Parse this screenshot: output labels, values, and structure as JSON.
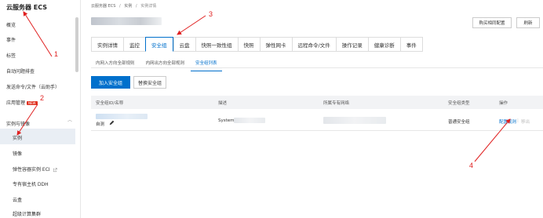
{
  "sidebar": {
    "title": "云服务器 ECS",
    "items": [
      {
        "label": "概览"
      },
      {
        "label": "事件"
      },
      {
        "label": "标签"
      },
      {
        "label": "自动问题排查"
      },
      {
        "label": "发送命令/文件（云助手）"
      },
      {
        "label": "应用管理",
        "badge": "NEW"
      },
      {
        "label": "实例与镜像"
      }
    ],
    "sub_items": [
      {
        "label": "实例"
      },
      {
        "label": "镜像"
      },
      {
        "label": "弹性容器实例 ECI"
      },
      {
        "label": "专有宿主机 DDH"
      },
      {
        "label": "云盒"
      },
      {
        "label": "超级计算集群"
      }
    ],
    "collapse_glyph": "︿"
  },
  "breadcrumb": [
    "云服务器 ECS",
    "/",
    "实例",
    "/",
    "实例详情"
  ],
  "header": {
    "buttons": [
      {
        "label": "购买相同配置"
      },
      {
        "label": "刷新"
      }
    ]
  },
  "tabs": [
    {
      "label": "实例详情"
    },
    {
      "label": "监控"
    },
    {
      "label": "安全组",
      "active": true
    },
    {
      "label": "云盘"
    },
    {
      "label": "快照一致性组"
    },
    {
      "label": "快照"
    },
    {
      "label": "弹性网卡"
    },
    {
      "label": "远程命令/文件"
    },
    {
      "label": "操作记录"
    },
    {
      "label": "健康诊断"
    },
    {
      "label": "事件"
    }
  ],
  "subtabs": [
    {
      "label": "内网入方向全部规则"
    },
    {
      "label": "内网出方向全部规则"
    },
    {
      "label": "安全组列表",
      "active": true
    }
  ],
  "actions": {
    "add_label": "加入安全组",
    "replace_label": "替换安全组"
  },
  "table": {
    "headers": [
      "安全组ID/名称",
      "描述",
      "所属专有网络",
      "安全组类型",
      "操作"
    ],
    "rows": [
      {
        "name": "自测",
        "description": "System",
        "type": "普通安全组",
        "op_config": "配置规则",
        "op_sep": "|",
        "op_remove": "移出"
      }
    ]
  },
  "annotations": [
    "1",
    "2",
    "3",
    "4"
  ],
  "colors": {
    "primary": "#0070cc",
    "annotation": "#e02020"
  }
}
